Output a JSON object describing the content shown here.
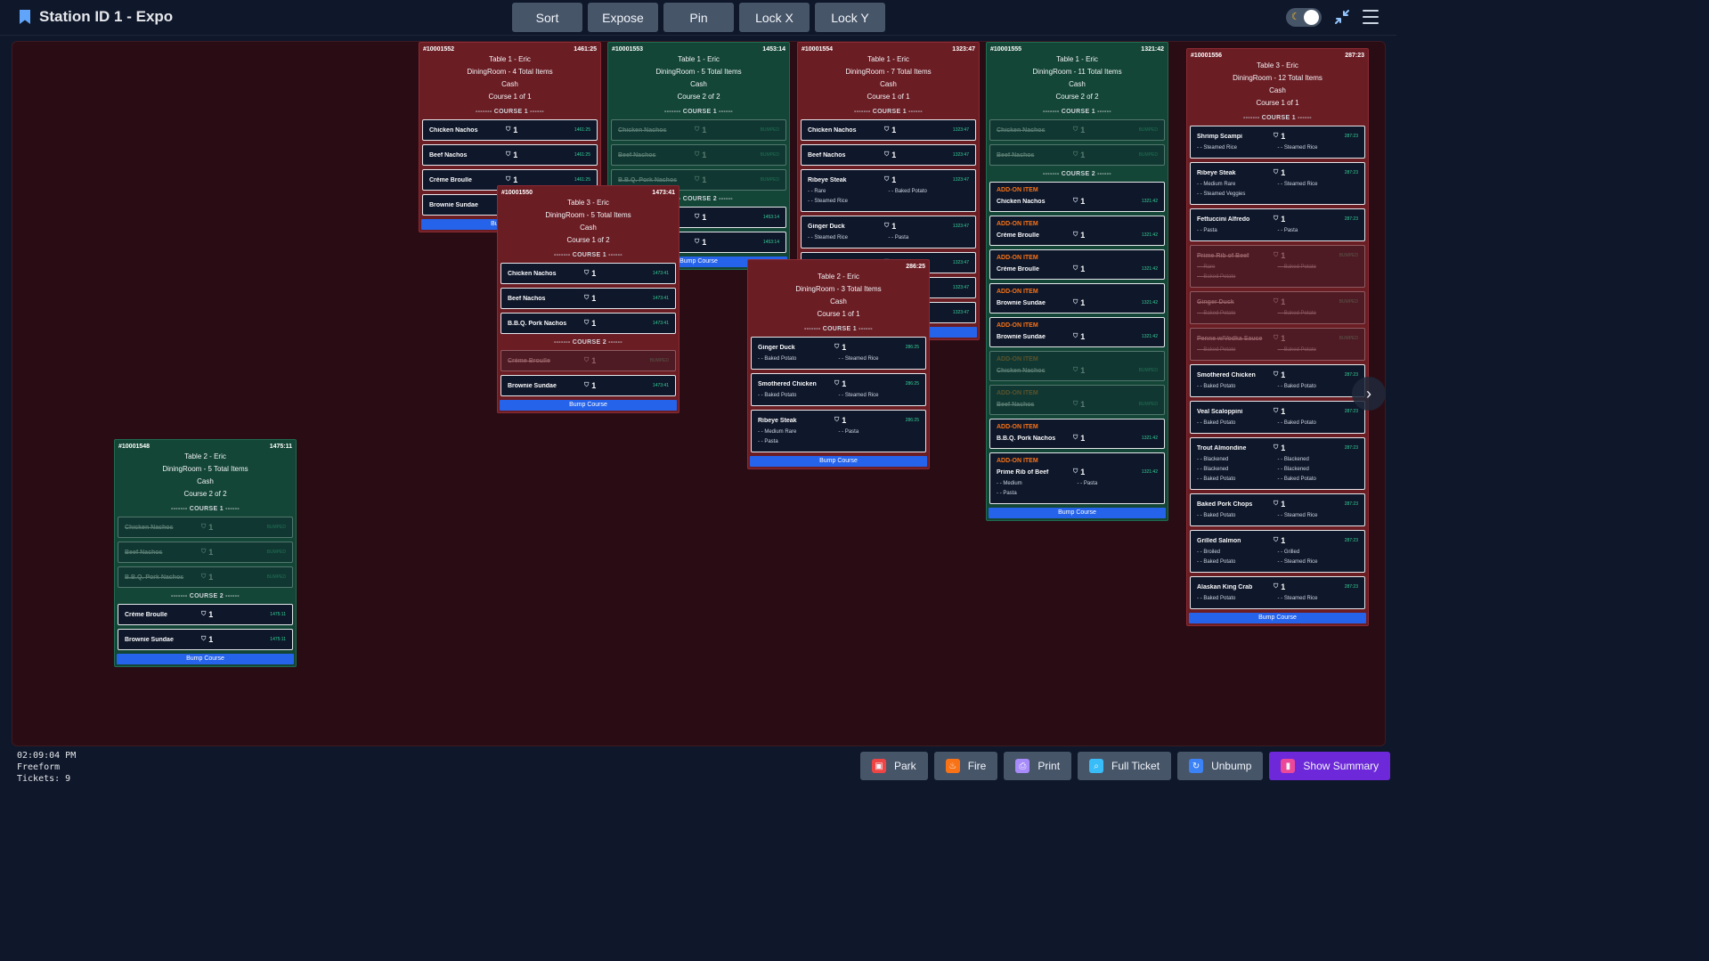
{
  "header": {
    "title": "Station ID 1 - Expo",
    "toolbar": [
      "Sort",
      "Expose",
      "Pin",
      "Lock X",
      "Lock Y"
    ]
  },
  "tickets": [
    {
      "id": "#10001552",
      "timer": "1461:25",
      "color": "red",
      "info": [
        "Table 1 - Eric",
        "DiningRoom - 4 Total Items",
        "Cash",
        "Course 1 of 1"
      ],
      "courses": [
        {
          "label": "------- COURSE 1 ------",
          "items": [
            {
              "name": "Chicken Nachos",
              "qty": "1",
              "time": "1461:25"
            },
            {
              "name": "Beef Nachos",
              "qty": "1",
              "time": "1461:25"
            },
            {
              "name": "Crème Broulle",
              "qty": "1",
              "time": "1461:25"
            },
            {
              "name": "Brownie Sundae",
              "qty": "1",
              "time": "1461:25"
            }
          ]
        }
      ],
      "bump": "Bump Course"
    },
    {
      "id": "#10001553",
      "timer": "1453:14",
      "color": "green",
      "info": [
        "Table 1 - Eric",
        "DiningRoom - 5 Total Items",
        "Cash",
        "Course 2 of 2"
      ],
      "courses": [
        {
          "label": "------- COURSE 1 ------",
          "items": [
            {
              "name": "Chicken Nachos",
              "qty": "1",
              "time": "BUMPED",
              "bumped": true
            },
            {
              "name": "Beef Nachos",
              "qty": "1",
              "time": "BUMPED",
              "bumped": true
            },
            {
              "name": "B.B.Q. Pork Nachos",
              "qty": "1",
              "time": "BUMPED",
              "bumped": true
            }
          ]
        },
        {
          "label": "------- COURSE 2 ------",
          "items": [
            {
              "name": "Crème Broulle",
              "qty": "1",
              "time": "1453:14"
            },
            {
              "name": "Brownie Sundae",
              "qty": "1",
              "time": "1453:14"
            }
          ]
        }
      ],
      "bump": "Bump Course"
    },
    {
      "id": "#10001554",
      "timer": "1323:47",
      "color": "red",
      "info": [
        "Table 1 - Eric",
        "DiningRoom - 7 Total Items",
        "Cash",
        "Course 1 of 1"
      ],
      "courses": [
        {
          "label": "------- COURSE 1 ------",
          "items": [
            {
              "name": "Chicken Nachos",
              "qty": "1",
              "time": "1323:47"
            },
            {
              "name": "Beef Nachos",
              "qty": "1",
              "time": "1323:47"
            },
            {
              "name": "Ribeye Steak",
              "qty": "1",
              "time": "1323:47",
              "mods": [
                "- - Rare",
                "- - Baked Potato",
                "- - Steamed Rice"
              ]
            },
            {
              "name": "Ginger Duck",
              "qty": "1",
              "time": "1323:47",
              "mods": [
                "- - Steamed Rice",
                "- - Pasta"
              ]
            },
            {
              "name": "Smothered Chicken",
              "qty": "1",
              "time": "1323:47"
            },
            {
              "name": "Veal Scaloppini",
              "qty": "1",
              "time": "1323:47"
            },
            {
              "name": "Grilled Salmon",
              "qty": "1",
              "time": "1323:47"
            }
          ]
        }
      ],
      "bump": "Bump Course"
    },
    {
      "id": "#10001555",
      "timer": "1321:42",
      "color": "green",
      "info": [
        "Table 1 - Eric",
        "DiningRoom - 11 Total Items",
        "Cash",
        "Course 2 of 2"
      ],
      "courses": [
        {
          "label": "------- COURSE 1 ------",
          "items": [
            {
              "name": "Chicken Nachos",
              "qty": "1",
              "time": "BUMPED",
              "bumped": true
            },
            {
              "name": "Beef Nachos",
              "qty": "1",
              "time": "BUMPED",
              "bumped": true
            }
          ]
        },
        {
          "label": "------- COURSE 2 ------",
          "items": [
            {
              "addon": "ADD-ON ITEM",
              "name": "Chicken Nachos",
              "qty": "1",
              "time": "1321:42"
            },
            {
              "addon": "ADD-ON ITEM",
              "name": "Crème Broulle",
              "qty": "1",
              "time": "1321:42"
            },
            {
              "addon": "ADD-ON ITEM",
              "name": "Crème Broulle",
              "qty": "1",
              "time": "1321:42"
            },
            {
              "addon": "ADD-ON ITEM",
              "name": "Brownie Sundae",
              "qty": "1",
              "time": "1321:42"
            },
            {
              "addon": "ADD-ON ITEM",
              "name": "Brownie Sundae",
              "qty": "1",
              "time": "1321:42"
            },
            {
              "addon": "ADD-ON ITEM",
              "name": "Chicken Nachos",
              "qty": "1",
              "time": "BUMPED",
              "bumped": true
            },
            {
              "addon": "ADD-ON ITEM",
              "name": "Beef Nachos",
              "qty": "1",
              "time": "BUMPED",
              "bumped": true
            },
            {
              "addon": "ADD-ON ITEM",
              "name": "B.B.Q. Pork Nachos",
              "qty": "1",
              "time": "1321:42"
            },
            {
              "addon": "ADD-ON ITEM",
              "name": "Prime Rib of Beef",
              "qty": "1",
              "time": "1321:42",
              "mods": [
                "- - Medium",
                "- - Pasta",
                "- - Pasta"
              ]
            }
          ]
        }
      ],
      "bump": "Bump Course"
    },
    {
      "id": "#10001556",
      "timer": "287:23",
      "color": "red",
      "info": [
        "Table 3 - Eric",
        "DiningRoom - 12 Total Items",
        "Cash",
        "Course 1 of 1"
      ],
      "courses": [
        {
          "label": "------- COURSE 1 ------",
          "items": [
            {
              "name": "Shrimp Scampi",
              "qty": "1",
              "time": "287:23",
              "mods": [
                "- - Steamed Rice",
                "- - Steamed Rice"
              ]
            },
            {
              "name": "Ribeye Steak",
              "qty": "1",
              "time": "287:23",
              "mods": [
                "- - Medium Rare",
                "- - Steamed Rice",
                "- - Steamed Veggies"
              ]
            },
            {
              "name": "Fettuccini Alfredo",
              "qty": "1",
              "time": "287:23",
              "mods": [
                "- - Pasta",
                "- - Pasta"
              ]
            },
            {
              "name": "Prime Rib of Beef",
              "qty": "1",
              "time": "BUMPED",
              "bumped": true,
              "mods": [
                "- - Rare",
                "- - Baked Potato",
                "- - Baked Potato"
              ]
            },
            {
              "name": "Ginger Duck",
              "qty": "1",
              "time": "BUMPED",
              "bumped": true,
              "mods": [
                "- - Baked Potato",
                "- - Baked Potato"
              ]
            },
            {
              "name": "Penne w/Vodka Sauce",
              "qty": "1",
              "time": "BUMPED",
              "bumped": true,
              "mods": [
                "- - Baked Potato",
                "- - Baked Potato"
              ]
            },
            {
              "name": "Smothered Chicken",
              "qty": "1",
              "time": "287:23",
              "mods": [
                "- - Baked Potato",
                "- - Baked Potato"
              ]
            },
            {
              "name": "Veal Scaloppini",
              "qty": "1",
              "time": "287:23",
              "mods": [
                "- - Baked Potato",
                "- - Baked Potato"
              ]
            },
            {
              "name": "Trout Almondine",
              "qty": "1",
              "time": "287:23",
              "mods": [
                "- - Blackened",
                "- - Blackened",
                "- - Blackened",
                "- - Blackened",
                "- - Baked Potato",
                "- - Baked Potato"
              ]
            },
            {
              "name": "Baked Pork Chops",
              "qty": "1",
              "time": "287:23",
              "mods": [
                "- - Baked Potato",
                "- - Steamed Rice"
              ]
            },
            {
              "name": "Grilled Salmon",
              "qty": "1",
              "time": "287:23",
              "mods": [
                "- - Broiled",
                "- - Grilled",
                "- - Baked Potato",
                "- - Steamed Rice"
              ]
            },
            {
              "name": "Alaskan King Crab",
              "qty": "1",
              "time": "287:23",
              "mods": [
                "- - Baked Potato",
                "- - Steamed Rice"
              ]
            }
          ]
        }
      ],
      "bump": "Bump Course"
    },
    {
      "id": "#10001548",
      "timer": "1475:11",
      "color": "green",
      "info": [
        "Table 2 - Eric",
        "DiningRoom - 5 Total Items",
        "Cash",
        "Course 2 of 2"
      ],
      "courses": [
        {
          "label": "------- COURSE 1 ------",
          "items": [
            {
              "name": "Chicken Nachos",
              "qty": "1",
              "time": "BUMPED",
              "bumped": true
            },
            {
              "name": "Beef Nachos",
              "qty": "1",
              "time": "BUMPED",
              "bumped": true
            },
            {
              "name": "B.B.Q. Pork Nachos",
              "qty": "1",
              "time": "BUMPED",
              "bumped": true
            }
          ]
        },
        {
          "label": "------- COURSE 2 ------",
          "items": [
            {
              "name": "Crème Broulle",
              "qty": "1",
              "time": "1475:11"
            },
            {
              "name": "Brownie Sundae",
              "qty": "1",
              "time": "1475:11"
            }
          ]
        }
      ],
      "bump": "Bump Course"
    },
    {
      "id": "#10001550",
      "timer": "1473:41",
      "color": "red",
      "info": [
        "Table 3 - Eric",
        "DiningRoom - 5 Total Items",
        "Cash",
        "Course 1 of 2"
      ],
      "courses": [
        {
          "label": "------- COURSE 1 ------",
          "items": [
            {
              "name": "Chicken Nachos",
              "qty": "1",
              "time": "1473:41"
            },
            {
              "name": "Beef Nachos",
              "qty": "1",
              "time": "1473:41"
            },
            {
              "name": "B.B.Q. Pork Nachos",
              "qty": "1",
              "time": "1473:41"
            }
          ]
        },
        {
          "label": "------- COURSE 2 ------",
          "items": [
            {
              "name": "Crème Broulle",
              "qty": "1",
              "time": "BUMPED",
              "bumped": true
            },
            {
              "name": "Brownie Sundae",
              "qty": "1",
              "time": "1473:41"
            }
          ]
        }
      ],
      "bump": "Bump Course"
    },
    {
      "id": "",
      "timer": "286:25",
      "color": "red",
      "info": [
        "Table 2 - Eric",
        "DiningRoom - 3 Total Items",
        "Cash",
        "Course 1 of 1"
      ],
      "courses": [
        {
          "label": "------- COURSE 1 ------",
          "items": [
            {
              "name": "Ginger Duck",
              "qty": "1",
              "time": "286:25",
              "mods": [
                "- - Baked Potato",
                "- - Steamed Rice"
              ]
            },
            {
              "name": "Smothered Chicken",
              "qty": "1",
              "time": "286:25",
              "mods": [
                "- - Baked Potato",
                "- - Steamed Rice"
              ]
            },
            {
              "name": "Ribeye Steak",
              "qty": "1",
              "time": "286:25",
              "mods": [
                "- - Medium Rare",
                "- - Pasta",
                "- - Pasta"
              ]
            }
          ]
        }
      ],
      "bump": "Bump Course"
    }
  ],
  "footer": {
    "status": [
      "02:09:04 PM",
      "Freeform",
      "Tickets: 9"
    ],
    "buttons": [
      {
        "label": "Park",
        "icon": "park-icon",
        "color": "#ef4444"
      },
      {
        "label": "Fire",
        "icon": "fire-icon",
        "color": "#f97316"
      },
      {
        "label": "Print",
        "icon": "print-icon",
        "color": "#a78bfa"
      },
      {
        "label": "Full Ticket",
        "icon": "magnify-icon",
        "color": "#38bdf8"
      },
      {
        "label": "Unbump",
        "icon": "unbump-icon",
        "color": "#3b82f6"
      },
      {
        "label": "Show Summary",
        "icon": "chart-icon",
        "color": "#ec4899"
      }
    ]
  },
  "colors": {
    "redTicket": "#6b1d24",
    "greenTicket": "#134636",
    "bump": "#2563eb",
    "addon": "#f97316",
    "timer": "#34d399"
  }
}
